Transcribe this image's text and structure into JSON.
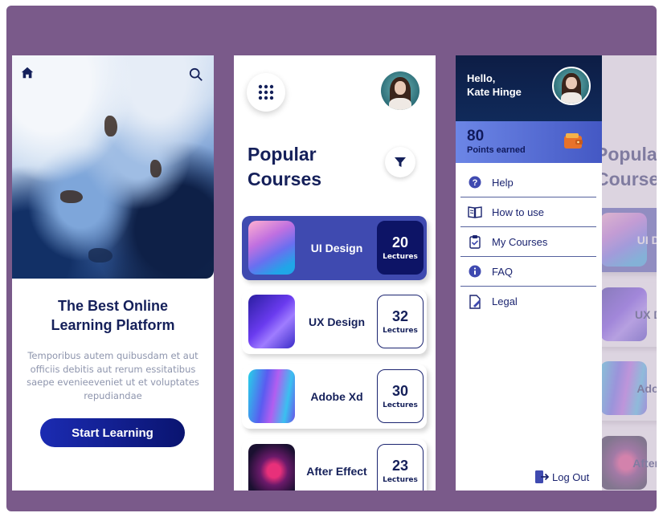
{
  "screen1": {
    "title": "The Best Online\nLearning Platform",
    "description": "Temporibus autem quibusdam et aut officiis debitis aut rerum essitatibus saepe evenieeveniet ut et voluptates repudiandae",
    "cta_label": "Start Learning",
    "icons": [
      "home-icon",
      "search-icon"
    ]
  },
  "screen2": {
    "heading": "Popular\nCourses",
    "courses": [
      {
        "name": "UI Design",
        "count": "20",
        "unit": "Lectures",
        "active": true
      },
      {
        "name": "UX Design",
        "count": "32",
        "unit": "Lectures",
        "active": false
      },
      {
        "name": "Adobe Xd",
        "count": "30",
        "unit": "Lectures",
        "active": false
      },
      {
        "name": "After Effect",
        "count": "23",
        "unit": "Lectures",
        "active": false
      }
    ],
    "icons": [
      "grid-menu-icon",
      "filter-icon"
    ]
  },
  "screen3": {
    "greeting": "Hello,\nKate Hinge",
    "points": "80",
    "points_label": "Points earned",
    "menu": [
      {
        "label": "Help",
        "icon": "help-icon"
      },
      {
        "label": "How to use",
        "icon": "book-icon"
      },
      {
        "label": "My Courses",
        "icon": "clipboard-icon"
      },
      {
        "label": "FAQ",
        "icon": "info-icon"
      },
      {
        "label": "Legal",
        "icon": "document-icon"
      }
    ],
    "logout_label": "Log Out"
  },
  "screen2_partial": {
    "heading": "Popular\nCourses",
    "courses": [
      {
        "name": "UI Design"
      },
      {
        "name": "UX Design"
      },
      {
        "name": "Adobe Xd"
      },
      {
        "name": "After Effect"
      }
    ]
  },
  "colors": {
    "frame_bg": "#7a5a8a",
    "navy": "#15205a",
    "accent": "#3f4ab0",
    "button": "#1b2bb2"
  }
}
